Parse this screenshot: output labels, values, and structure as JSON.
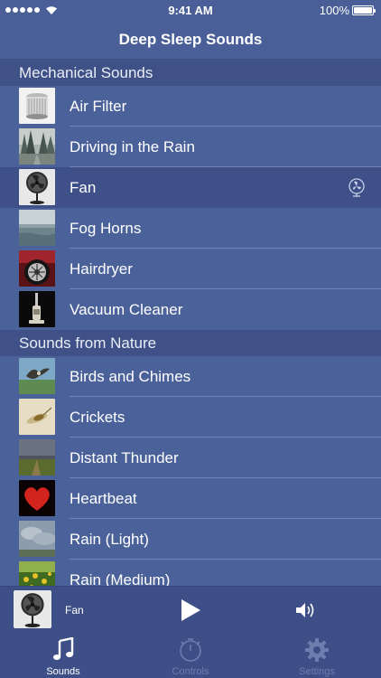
{
  "status_bar": {
    "time": "9:41 AM",
    "battery": "100%"
  },
  "nav": {
    "title": "Deep Sleep Sounds"
  },
  "sections": [
    {
      "title": "Mechanical Sounds",
      "items": [
        {
          "label": "Air Filter",
          "icon": "air-filter-thumbnail"
        },
        {
          "label": "Driving in the Rain",
          "icon": "forest-road-thumbnail"
        },
        {
          "label": "Fan",
          "icon": "fan-thumbnail",
          "selected": true
        },
        {
          "label": "Fog Horns",
          "icon": "misty-water-thumbnail"
        },
        {
          "label": "Hairdryer",
          "icon": "car-wheel-thumbnail"
        },
        {
          "label": "Vacuum Cleaner",
          "icon": "vacuum-thumbnail"
        }
      ]
    },
    {
      "title": "Sounds from Nature",
      "items": [
        {
          "label": "Birds and Chimes",
          "icon": "bird-thumbnail"
        },
        {
          "label": "Crickets",
          "icon": "cricket-thumbnail"
        },
        {
          "label": "Distant Thunder",
          "icon": "storm-field-thumbnail"
        },
        {
          "label": "Heartbeat",
          "icon": "heart-thumbnail"
        },
        {
          "label": "Rain (Light)",
          "icon": "cloudy-sky-thumbnail"
        },
        {
          "label": "Rain (Medium)",
          "icon": "flower-field-thumbnail"
        }
      ]
    }
  ],
  "now_playing": {
    "title": "Fan"
  },
  "tabs": [
    {
      "label": "Sounds",
      "icon": "music-note-icon",
      "active": true
    },
    {
      "label": "Controls",
      "icon": "timer-icon",
      "active": false
    },
    {
      "label": "Settings",
      "icon": "gear-icon",
      "active": false
    }
  ],
  "colors": {
    "background": "#4b6199",
    "section_header": "#3f5186",
    "selected_row": "#3e5087",
    "bars": "#3d4f86",
    "inactive_tab": "#6d7eae"
  }
}
